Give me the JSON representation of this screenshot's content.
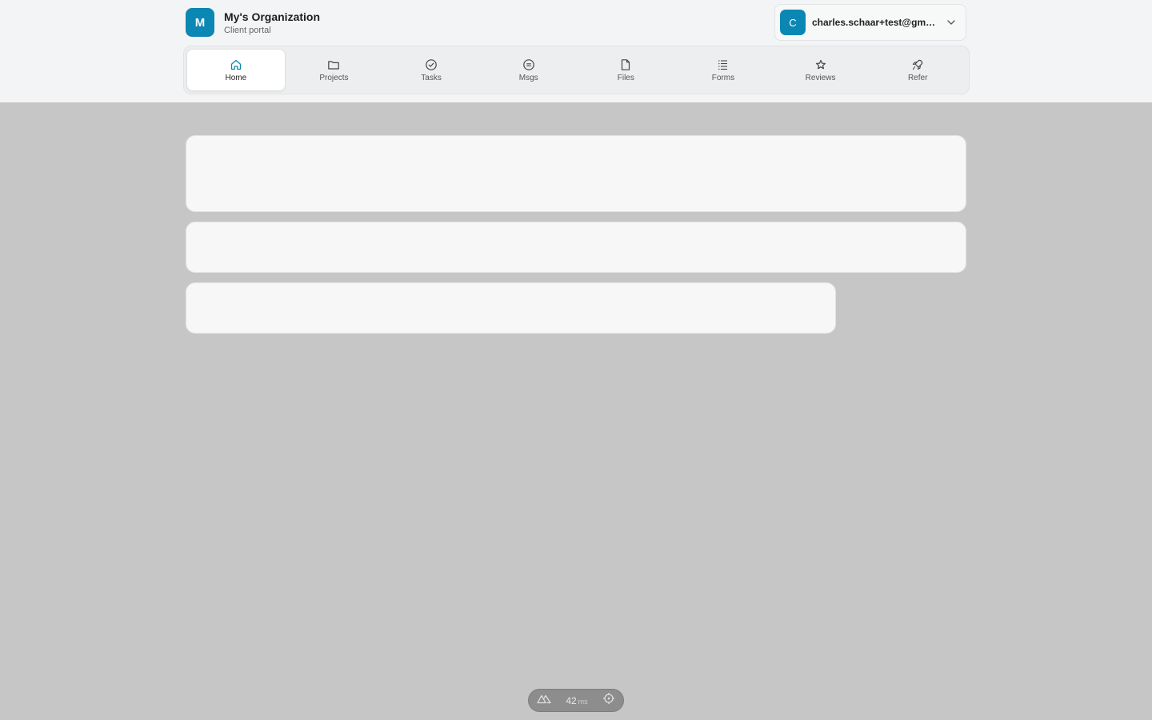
{
  "brand": {
    "initial": "M",
    "name": "My's Organization",
    "subtitle": "Client portal",
    "color": "#0b87b3"
  },
  "user": {
    "initial": "C",
    "email": "charles.schaar+test@gmail....",
    "menu_icon": "chevron-down-icon"
  },
  "nav": {
    "items": [
      {
        "label": "Home",
        "icon": "home-icon",
        "active": true
      },
      {
        "label": "Projects",
        "icon": "folder-icon",
        "active": false
      },
      {
        "label": "Tasks",
        "icon": "check-circle-icon",
        "active": false
      },
      {
        "label": "Msgs",
        "icon": "message-icon",
        "active": false
      },
      {
        "label": "Files",
        "icon": "file-icon",
        "active": false
      },
      {
        "label": "Forms",
        "icon": "list-icon",
        "active": false
      },
      {
        "label": "Reviews",
        "icon": "star-icon",
        "active": false
      },
      {
        "label": "Refer",
        "icon": "rocket-icon",
        "active": false
      }
    ]
  },
  "devtools": {
    "ms_value": "42",
    "ms_unit": "ms",
    "logo_icon": "nuxt-logo-icon",
    "target_icon": "crosshair-icon"
  }
}
